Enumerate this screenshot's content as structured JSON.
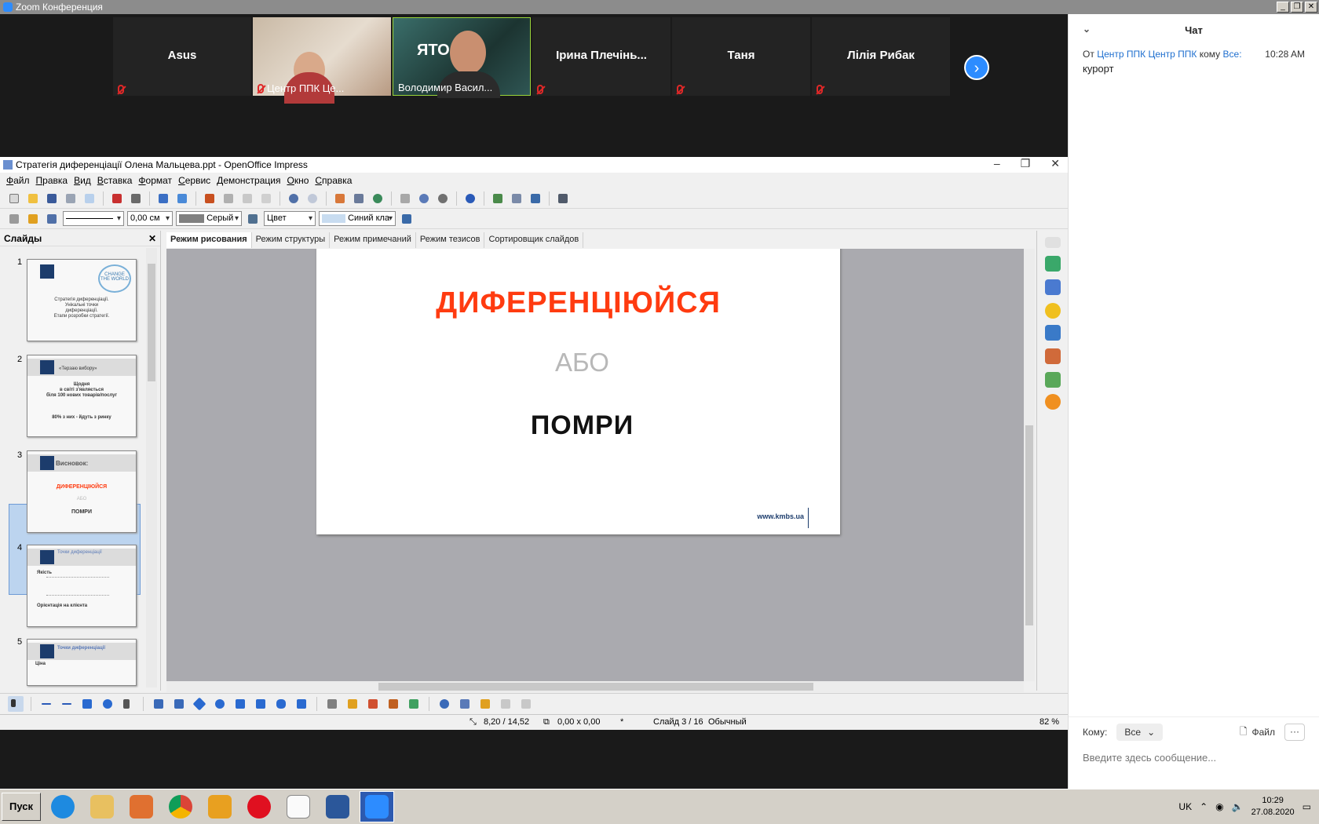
{
  "zoom": {
    "window_title": "Zoom Конференция",
    "participants": [
      {
        "name": "Asus",
        "label": ""
      },
      {
        "name": "",
        "label": "Центр ППК Це..."
      },
      {
        "name": "",
        "label": "Володимир Васил..."
      },
      {
        "name": "Ірина  Плечінь...",
        "label": ""
      },
      {
        "name": "Таня",
        "label": ""
      },
      {
        "name": "Лілія Рибак",
        "label": ""
      }
    ],
    "video_overlay_text": "ЯТО"
  },
  "chat": {
    "title": "Чат",
    "messages": [
      {
        "prefix": "От",
        "sender": "Центр ППК Центр ППК",
        "to_word": "кому",
        "recipient": "Все:",
        "time": "10:28 AM",
        "text": "курорт"
      }
    ],
    "to_label": "Кому:",
    "to_value": "Все",
    "file_label": "Файл",
    "more_label": "···",
    "input_placeholder": "Введите здесь сообщение..."
  },
  "impress": {
    "title": "Стратегія диференціації Олена Мальцева.ppt - OpenOffice Impress",
    "menu": [
      "Файл",
      "Правка",
      "Вид",
      "Вставка",
      "Формат",
      "Сервис",
      "Демонстрация",
      "Окно",
      "Справка"
    ],
    "line_width": "0,00 см",
    "line_color": "Серый",
    "fill_type": "Цвет",
    "fill_color": "Синий кла",
    "slides_panel_title": "Слайды",
    "view_tabs": [
      "Режим рисования",
      "Режим структуры",
      "Режим примечаний",
      "Режим тезисов",
      "Сортировщик слайдов"
    ],
    "thumbs": [
      {
        "num": "1",
        "lines": [
          "Стратегія диференціації.",
          "Унікальні точки",
          "диференціації.",
          "Етапи розробки стратегії."
        ],
        "badge": "CHANGE THE WORLD"
      },
      {
        "num": "2",
        "lines": [
          "«Терзаю вибору»",
          "Щодня",
          "в світі з'являється",
          "біля 100 нових товарів/послуг",
          "80% з них - йдуть з ринку"
        ]
      },
      {
        "num": "3",
        "lines": [
          "Висновок:",
          "ДИФЕРЕНЦІЮЙСЯ",
          "АБО",
          "ПОМРИ"
        ]
      },
      {
        "num": "4",
        "lines": [
          "Точки диференціації",
          "Якість",
          "Орієнтація на клієнта"
        ]
      },
      {
        "num": "5",
        "lines": [
          "Точки диференціації",
          "Ціна"
        ]
      }
    ],
    "slide": {
      "headline": "ДИФЕРЕНЦІЮЙСЯ",
      "or_text": "АБО",
      "die_text": "ПОМРИ",
      "url": "www.kmbs.ua"
    },
    "status": {
      "position": "8,20 / 14,52",
      "size": "0,00 x 0,00",
      "modified": "*",
      "slide_no": "Слайд 3 / 16",
      "layout": "Обычный",
      "zoom": "82 %"
    }
  },
  "taskbar": {
    "start_label": "Пуск",
    "lang": "UK",
    "time": "10:29",
    "date": "27.08.2020"
  },
  "colors": {
    "zoom_blue": "#2d8cff",
    "headline_red": "#ff3b10",
    "muted_red": "#e02828"
  }
}
